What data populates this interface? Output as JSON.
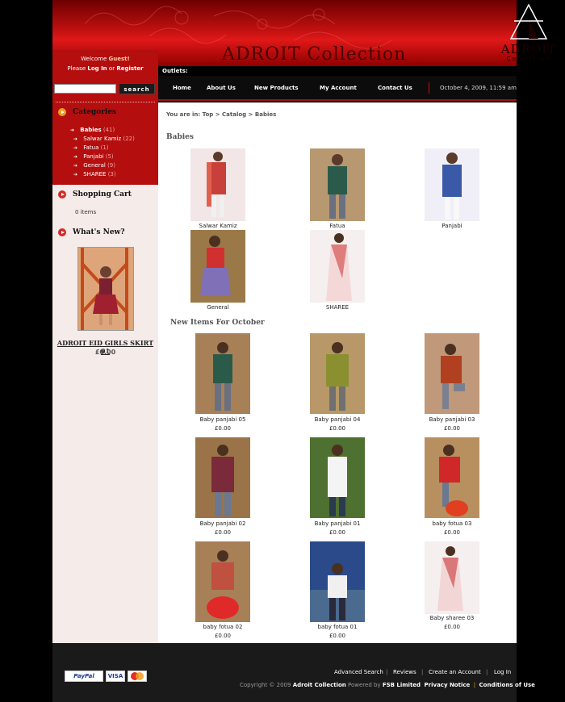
{
  "header": {
    "brand_banner": "ADROIT Collection",
    "logo_name": "ADROIT",
    "logo_sub": "Collection",
    "outlets_label": "Outlets:"
  },
  "nav": {
    "items": [
      "Home",
      "About Us",
      "New Products",
      "My Account",
      "Contact Us"
    ],
    "datetime": "October 4, 2009, 11:59 am"
  },
  "sidebar": {
    "welcome_prefix": "Welcome",
    "welcome_user": "Guest!",
    "please": "Please",
    "login": "Log In",
    "or": "or",
    "register": "Register",
    "search_button": "search",
    "search_placeholder": "",
    "categories_title": "Categories",
    "categories": [
      {
        "label": "Babies",
        "count": "(41)"
      },
      {
        "label": "Salwar Kamiz",
        "count": "(22)"
      },
      {
        "label": "Fatua",
        "count": "(1)"
      },
      {
        "label": "Panjabi",
        "count": "(5)"
      },
      {
        "label": "General",
        "count": "(9)"
      },
      {
        "label": "SHAREE",
        "count": "(3)"
      }
    ],
    "cart_title": "Shopping Cart",
    "cart_items": "0 items",
    "whatsnew_title": "What's New?",
    "whatsnew_product": "ADROIT EID GIRLS SKIRT 01",
    "whatsnew_price": "£0.00"
  },
  "main": {
    "breadcrumb_label": "You are in:",
    "breadcrumb_path": "Top > Catalog > Babies",
    "section_title": "Babies",
    "subcategories": [
      "Salwar Kamiz",
      "Fatua",
      "Panjabi",
      "General",
      "SHAREE"
    ],
    "new_items_title": "New Items For October",
    "new_items": [
      {
        "name": "Baby panjabi 05",
        "price": "£0.00"
      },
      {
        "name": "Baby panjabi 04",
        "price": "£0.00"
      },
      {
        "name": "Baby panjabi 03",
        "price": "£0.00"
      },
      {
        "name": "Baby panjabi 02",
        "price": "£0.00"
      },
      {
        "name": "Baby panjabi 01",
        "price": "£0.00"
      },
      {
        "name": "baby fotua 03",
        "price": "£0.00"
      },
      {
        "name": "baby fotua 02",
        "price": "£0.00"
      },
      {
        "name": "baby fotua 01",
        "price": "£0.00"
      },
      {
        "name": "Baby sharee 03",
        "price": "£0.00"
      }
    ]
  },
  "footer": {
    "links": [
      "Advanced Search",
      "Reviews",
      "Create an Account",
      "Log In"
    ],
    "copyright_prefix": "Copyright © 2009",
    "site_name": "Adroit Collection",
    "powered_by": "Powered by",
    "company": "FSB Limited",
    "privacy": "Privacy Notice",
    "conditions": "Conditions of Use",
    "payment_paypal": "PayPal",
    "payment_visa": "VISA"
  },
  "colors": {
    "accent": "#b40e0e",
    "circle_icon": "#d42a2a",
    "orange_icon": "#e8a020"
  }
}
